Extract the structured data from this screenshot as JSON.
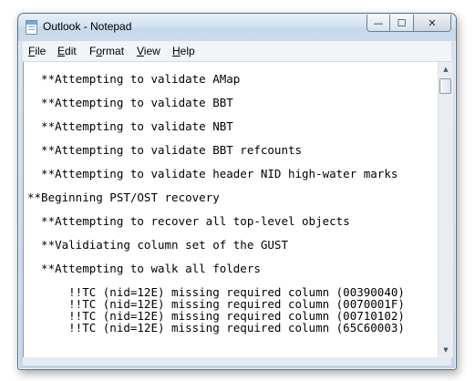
{
  "window": {
    "title": "Outlook - Notepad",
    "controls": {
      "minimize": "—",
      "maximize": "☐",
      "close": "✕"
    }
  },
  "menu": {
    "items": [
      {
        "label": "File",
        "mnemonic": "F",
        "rest": "ile"
      },
      {
        "label": "Edit",
        "mnemonic": "E",
        "rest": "dit"
      },
      {
        "label": "Format",
        "mnemonic": "o",
        "prefix": "F",
        "rest": "rmat"
      },
      {
        "label": "View",
        "mnemonic": "V",
        "rest": "iew"
      },
      {
        "label": "Help",
        "mnemonic": "H",
        "rest": "elp"
      }
    ]
  },
  "document": {
    "lines": [
      "  **Attempting to validate AMap",
      "  **Attempting to validate BBT",
      "  **Attempting to validate NBT",
      "  **Attempting to validate BBT refcounts",
      "  **Attempting to validate header NID high-water marks",
      "**Beginning PST/OST recovery",
      "  **Attempting to recover all top-level objects",
      "  **Validiating column set of the GUST",
      "  **Attempting to walk all folders",
      "      !!TC (nid=12E) missing required column (00390040)",
      "      !!TC (nid=12E) missing required column (0070001F)",
      "      !!TC (nid=12E) missing required column (00710102)",
      "      !!TC (nid=12E) missing required column (65C60003)"
    ]
  },
  "scrollbar": {
    "up_arrow": "▲",
    "down_arrow": "▼",
    "position": 0.0
  },
  "colors": {
    "title_bar": "#cadbe9",
    "window_frame": "#5d6f80",
    "menu_bg": "#f2f4f7"
  }
}
